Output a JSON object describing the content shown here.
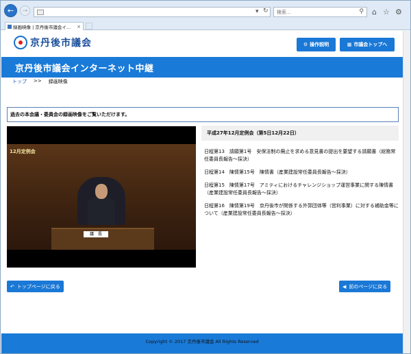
{
  "browser": {
    "search_placeholder": "検索...",
    "tab_title": "録画映像 | 京丹後市議会イ..."
  },
  "site": {
    "logo_text": "京丹後市議会",
    "buttons": {
      "manual": "操作説明",
      "council_top": "市議会トップへ"
    },
    "banner_title": "京丹後市議会インターネット中継"
  },
  "breadcrumb": {
    "top": "トップ",
    "sep": ">>",
    "current": "録画映像"
  },
  "notice": "過去の本会議・委員会の録画映像をご覧いただけます。",
  "video": {
    "caption": "12月定例会",
    "nameplate": "議　長"
  },
  "session": {
    "title": "平成27年12月定例会（第5日12月22日）",
    "items": [
      "日程第13　請願第1号　安保法制の廃止を求める意見書の提出を要望する請願書（総務常任委員長報告～採決）",
      "日程第14　陳情第15号　陳情書（産業建設常任委員長報告～採決）",
      "日程第15　陳情第17号　アミティにおけるチャレンジショップ運営事業に関する陳情書（産業建設常任委員長報告～採決）",
      "日程第16　陳情第19号　京丹後市が関係する外郭団体等（営利事業）に対する補助金等について（産業建設常任委員長報告～採決）"
    ]
  },
  "nav": {
    "to_top": "トップページに戻る",
    "back": "前のページに戻る"
  },
  "footer": "Copyright © 2017 京丹後市議会 All Rights Reserved",
  "colors": {
    "accent": "#1a7ad8",
    "logo_red": "#e02020"
  }
}
